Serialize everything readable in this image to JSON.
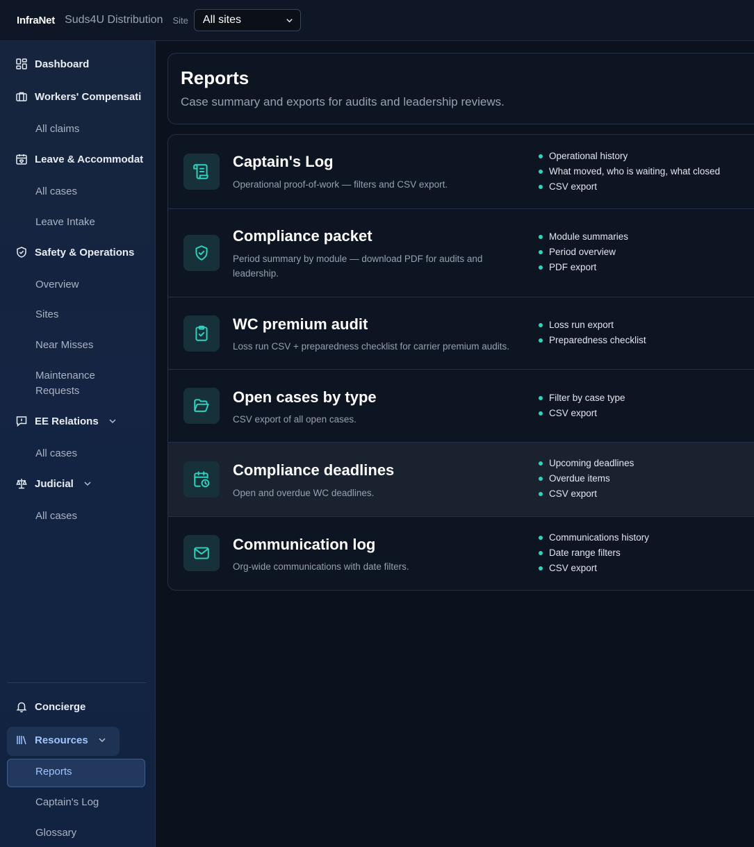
{
  "topbar": {
    "brand": "InfraNet",
    "org": "Suds4U Distribution",
    "site_label": "Site",
    "site_value": "All sites"
  },
  "sidebar": {
    "dashboard": "Dashboard",
    "workers_comp": "Workers' Compensati",
    "workers_comp_sub": [
      "All claims"
    ],
    "leave": "Leave & Accommodat",
    "leave_sub": [
      "All cases",
      "Leave Intake"
    ],
    "safety": "Safety & Operations",
    "safety_sub": [
      "Overview",
      "Sites",
      "Near Misses",
      "Maintenance Requests"
    ],
    "ee_relations": "EE Relations",
    "ee_sub": [
      "All cases"
    ],
    "judicial": "Judicial",
    "judicial_sub": [
      "All cases"
    ],
    "concierge": "Concierge",
    "resources": "Resources",
    "resources_sub": [
      "Reports",
      "Captain's Log",
      "Glossary"
    ]
  },
  "page": {
    "title": "Reports",
    "subtitle": "Case summary and exports for audits and leadership reviews."
  },
  "reports": [
    {
      "title": "Captain's Log",
      "icon": "scroll-icon",
      "desc": "Operational proof-of-work — filters and CSV export.",
      "bullets": [
        "Operational history",
        "What moved, who is waiting, what closed",
        "CSV export"
      ]
    },
    {
      "title": "Compliance packet",
      "icon": "shield-check-icon",
      "desc": "Period summary by module — download PDF for audits and leadership.",
      "bullets": [
        "Module summaries",
        "Period overview",
        "PDF export"
      ]
    },
    {
      "title": "WC premium audit",
      "icon": "clipboard-check-icon",
      "desc": "Loss run CSV + preparedness checklist for carrier premium audits.",
      "bullets": [
        "Loss run export",
        "Preparedness checklist"
      ]
    },
    {
      "title": "Open cases by type",
      "icon": "folder-open-icon",
      "desc": "CSV export of all open cases.",
      "bullets": [
        "Filter by case type",
        "CSV export"
      ]
    },
    {
      "title": "Compliance deadlines",
      "icon": "calendar-clock-icon",
      "desc": "Open and overdue WC deadlines.",
      "bullets": [
        "Upcoming deadlines",
        "Overdue items",
        "CSV export"
      ]
    },
    {
      "title": "Communication log",
      "icon": "mail-icon",
      "desc": "Org-wide communications with date filters.",
      "bullets": [
        "Communications history",
        "Date range filters",
        "CSV export"
      ]
    }
  ],
  "colors": {
    "accent": "#2dd4bf",
    "background": "#0b111d",
    "sidebar": "#14243f",
    "active_nav": "#22395d"
  }
}
